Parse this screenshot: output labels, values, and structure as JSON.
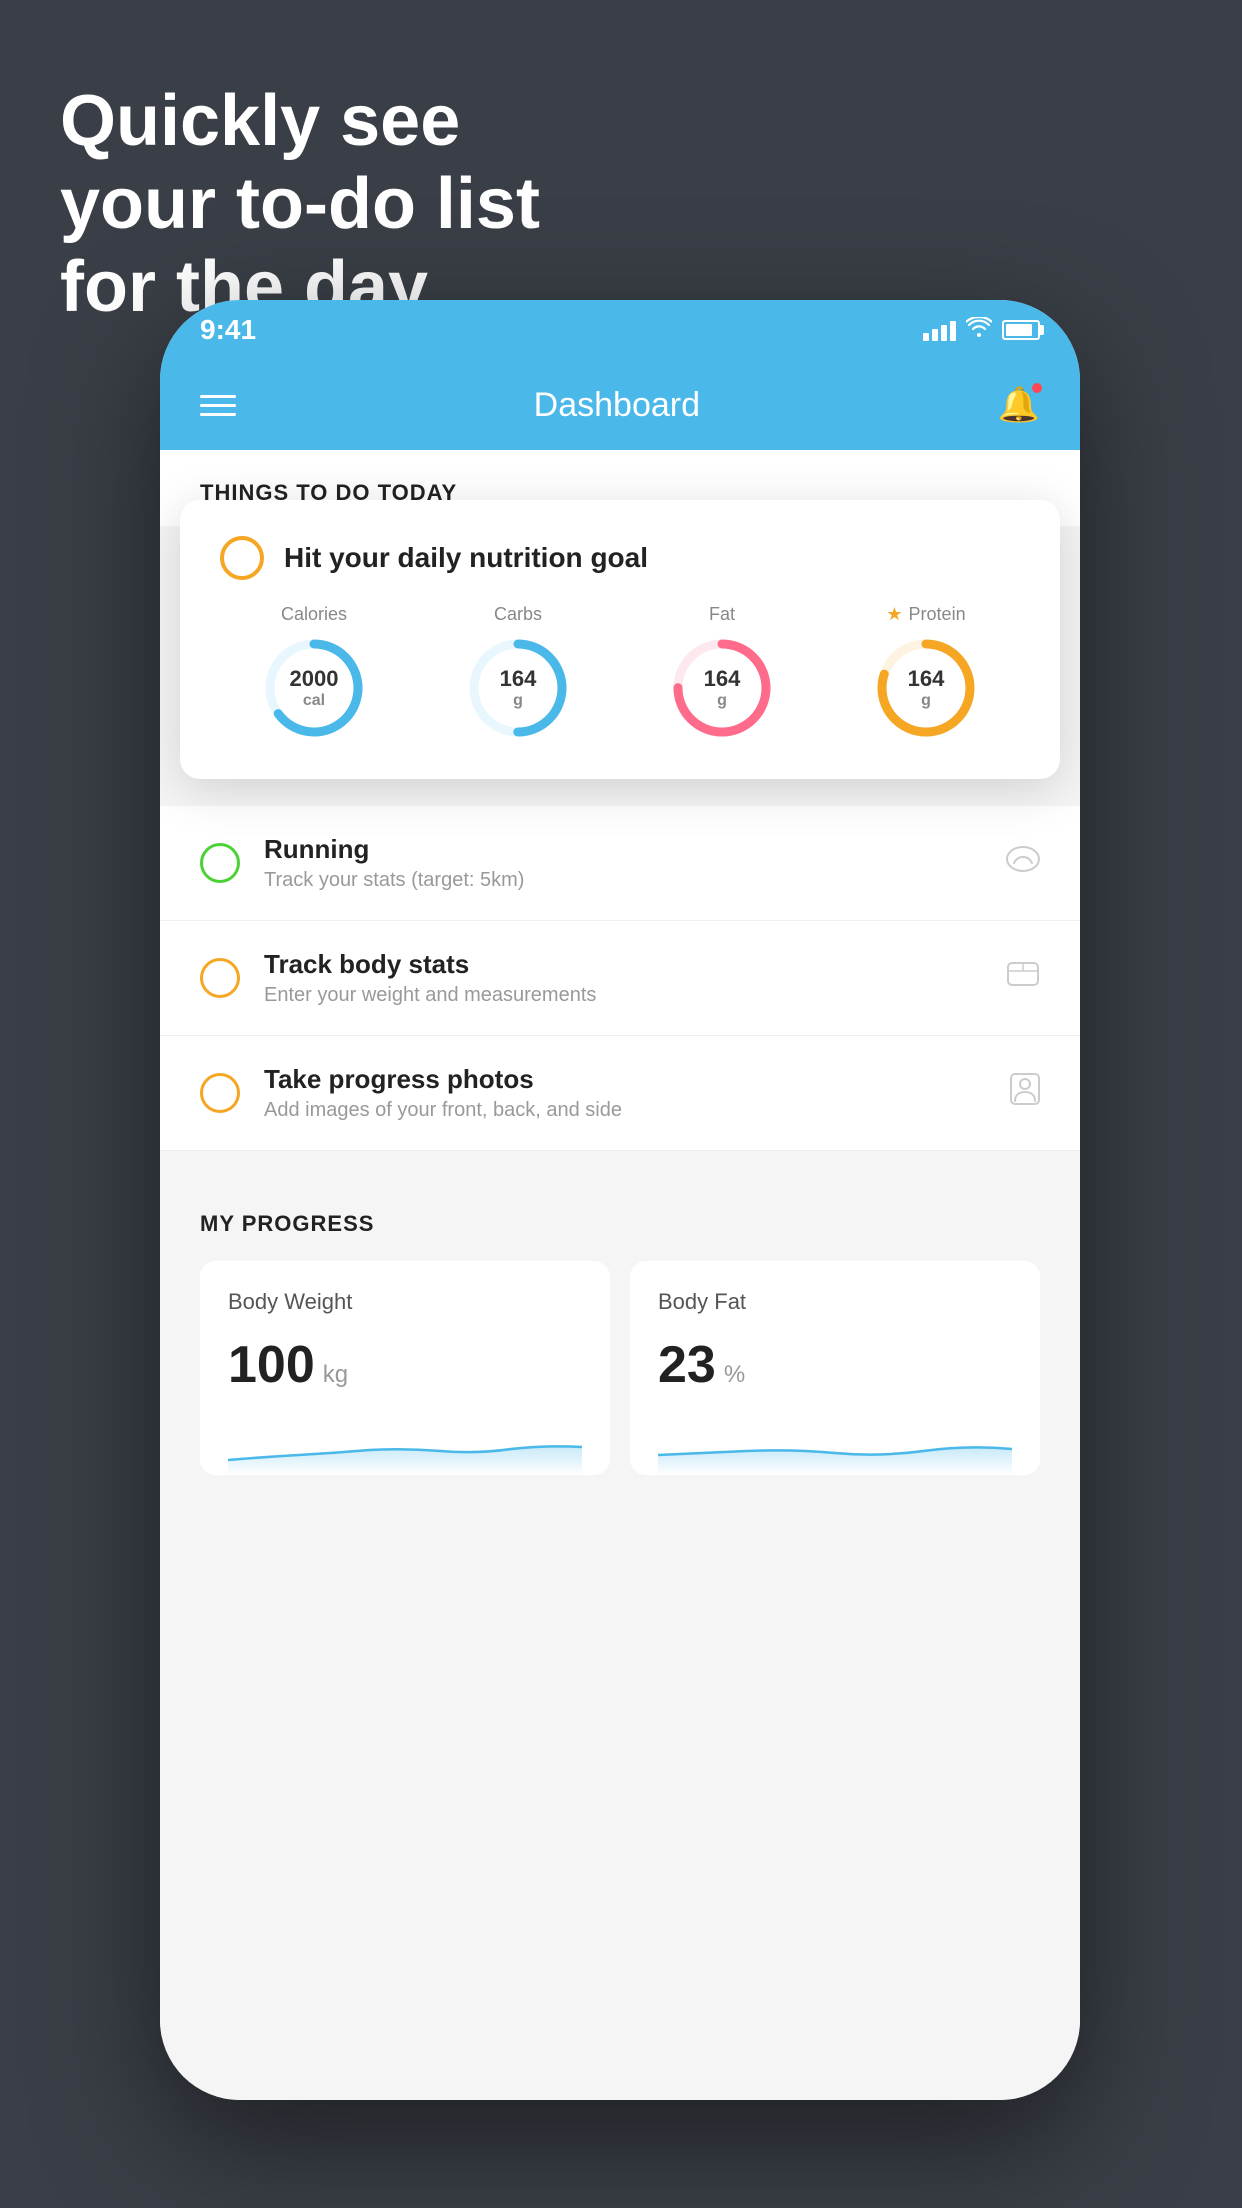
{
  "background": {
    "color": "#3a3f47"
  },
  "headline": {
    "line1": "Quickly see",
    "line2": "your to-do list",
    "line3": "for the day."
  },
  "statusBar": {
    "time": "9:41"
  },
  "header": {
    "title": "Dashboard"
  },
  "sections": {
    "todayTitle": "THINGS TO DO TODAY",
    "progressTitle": "MY PROGRESS"
  },
  "floatingCard": {
    "title": "Hit your daily nutrition goal",
    "nutrition": [
      {
        "label": "Calories",
        "value": "2000",
        "unit": "cal",
        "color": "#4ab8e8",
        "progress": 65
      },
      {
        "label": "Carbs",
        "value": "164",
        "unit": "g",
        "color": "#4ab8e8",
        "progress": 50
      },
      {
        "label": "Fat",
        "value": "164",
        "unit": "g",
        "color": "#ff6b8a",
        "progress": 75
      },
      {
        "label": "Protein",
        "value": "164",
        "unit": "g",
        "color": "#f5a623",
        "progress": 80,
        "star": true
      }
    ]
  },
  "todoItems": [
    {
      "name": "Running",
      "sub": "Track your stats (target: 5km)",
      "circleColor": "green",
      "icon": "👟"
    },
    {
      "name": "Track body stats",
      "sub": "Enter your weight and measurements",
      "circleColor": "yellow",
      "icon": "⚖"
    },
    {
      "name": "Take progress photos",
      "sub": "Add images of your front, back, and side",
      "circleColor": "yellow",
      "icon": "👤"
    }
  ],
  "progress": [
    {
      "title": "Body Weight",
      "value": "100",
      "unit": "kg"
    },
    {
      "title": "Body Fat",
      "value": "23",
      "unit": "%"
    }
  ]
}
